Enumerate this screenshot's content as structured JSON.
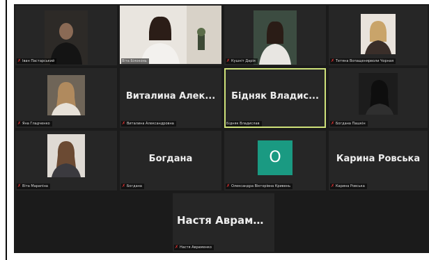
{
  "participants": [
    {
      "id": "p1",
      "label": "Іван Пастарський",
      "muted": true,
      "type": "video",
      "bg": "#2c2b2a"
    },
    {
      "id": "p2",
      "label": "Віта Білоконь",
      "muted": false,
      "type": "video",
      "bg": "#e8e4de"
    },
    {
      "id": "p3",
      "label": "Кушніт Дарія",
      "muted": true,
      "type": "video",
      "bg": "#3a4a3f"
    },
    {
      "id": "p4",
      "label": "Тетяна Вопащенярволи Чорная",
      "muted": true,
      "type": "video",
      "bg": "#3b3531"
    },
    {
      "id": "p5",
      "label": "Яна Гладченко",
      "muted": true,
      "type": "video",
      "bg": "#565049"
    },
    {
      "id": "p6",
      "name": "Виталина Алек...",
      "label": "Виталина Александровна",
      "muted": true,
      "type": "name"
    },
    {
      "id": "p7",
      "name": "Бідняк Владис...",
      "label": "Бідняк Владислав",
      "muted": false,
      "type": "name",
      "active": true
    },
    {
      "id": "p8",
      "label": "Богдана Пашкін",
      "muted": true,
      "type": "video",
      "bg": "#1f1f1f"
    },
    {
      "id": "p9",
      "label": "Віта Марапіна",
      "muted": true,
      "type": "video",
      "bg": "#3d3b39"
    },
    {
      "id": "p10",
      "name": "Богдана",
      "label": "Богдана",
      "muted": true,
      "type": "name"
    },
    {
      "id": "p11",
      "initial": "О",
      "label": "Олександра Вікторівна Кривень",
      "muted": true,
      "type": "avatar"
    },
    {
      "id": "p12",
      "name": "Карина Ровська",
      "label": "Карина Ровська",
      "muted": true,
      "type": "name"
    },
    {
      "id": "p13",
      "name": "Настя Аврамен...",
      "label": "Настя Авраменко",
      "muted": true,
      "type": "name"
    }
  ],
  "colors": {
    "stage": "#1b1b1b",
    "tile": "#262626",
    "active_border": "#cfe27a",
    "mic_off": "#e33333",
    "avatar": "#1a9a82"
  },
  "icons": {
    "mic_off": "mic-off-icon"
  }
}
